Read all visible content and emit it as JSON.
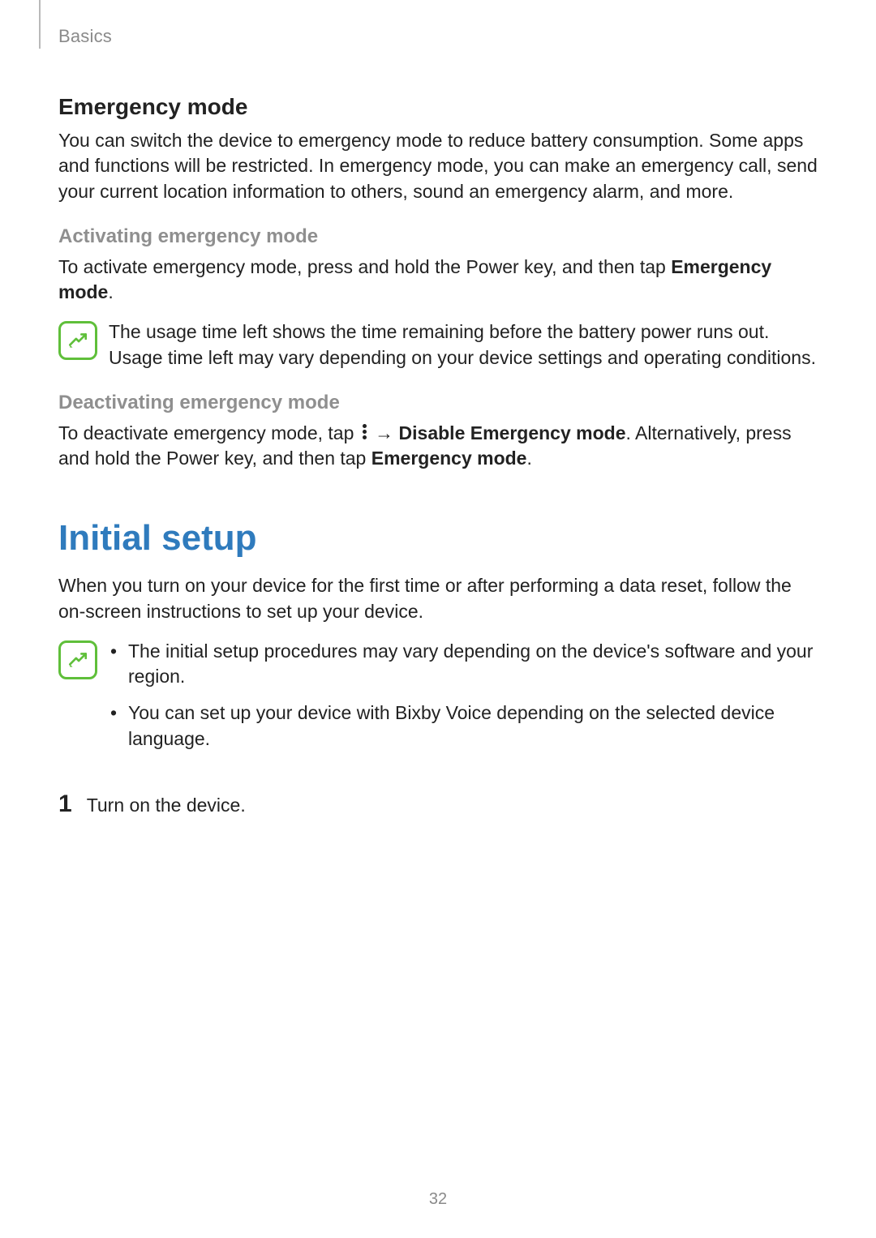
{
  "header": {
    "breadcrumb": "Basics"
  },
  "emergency": {
    "heading": "Emergency mode",
    "intro": "You can switch the device to emergency mode to reduce battery consumption. Some apps and functions will be restricted. In emergency mode, you can make an emergency call, send your current location information to others, sound an emergency alarm, and more.",
    "activating_heading": "Activating emergency mode",
    "activating_pre": "To activate emergency mode, press and hold the Power key, and then tap ",
    "activating_bold": "Emergency mode",
    "activating_post": ".",
    "activating_note": "The usage time left shows the time remaining before the battery power runs out. Usage time left may vary depending on your device settings and operating conditions.",
    "deactivating_heading": "Deactivating emergency mode",
    "deactivating_p1": "To deactivate emergency mode, tap ",
    "deactivating_arrow": "→",
    "deactivating_bold1": "Disable Emergency mode",
    "deactivating_p2": ". Alternatively, press and hold the Power key, and then tap ",
    "deactivating_bold2": "Emergency mode",
    "deactivating_p3": "."
  },
  "initial_setup": {
    "heading": "Initial setup",
    "intro": "When you turn on your device for the first time or after performing a data reset, follow the on-screen instructions to set up your device.",
    "note_items": [
      "The initial setup procedures may vary depending on the device's software and your region.",
      "You can set up your device with Bixby Voice depending on the selected device language."
    ],
    "step1_num": "1",
    "step1_text": "Turn on the device."
  },
  "page_number": "32"
}
